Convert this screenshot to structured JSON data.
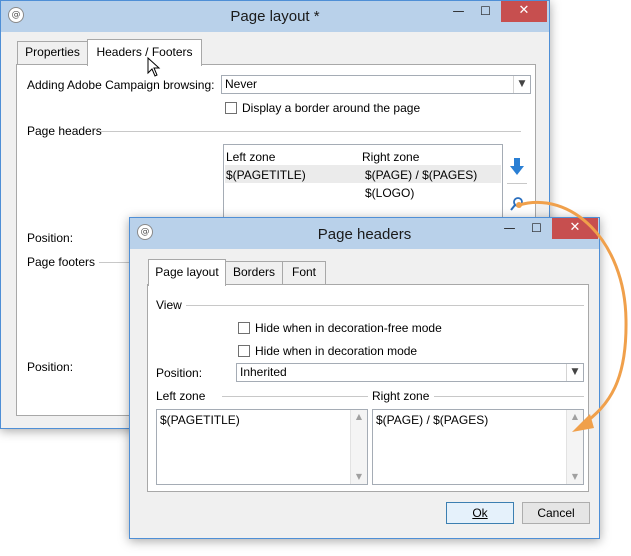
{
  "main_window": {
    "title": "Page layout *",
    "controls": {
      "minimize": "—",
      "maximize": "☐",
      "close": "✕"
    },
    "tabs": [
      {
        "label": "Properties",
        "active": false
      },
      {
        "label": "Headers / Footers",
        "active": true
      }
    ],
    "browsing_label": "Adding Adobe Campaign browsing:",
    "browsing_value": "Never",
    "border_checkbox_label": "Display a border around the page",
    "page_headers_label": "Page headers",
    "headers_table": {
      "columns": [
        "Left zone",
        "Right zone"
      ],
      "rows": [
        [
          "$(PAGETITLE)",
          "$(PAGE) / $(PAGES)"
        ],
        [
          "",
          "$(LOGO)"
        ]
      ]
    },
    "position_label": "Position:",
    "page_footers_label": "Page footers",
    "footer_position_label": "Position:"
  },
  "dialog": {
    "title": "Page headers",
    "controls": {
      "minimize": "—",
      "maximize": "☐",
      "close": "✕"
    },
    "tabs": [
      {
        "label": "Page layout",
        "active": true
      },
      {
        "label": "Borders",
        "active": false
      },
      {
        "label": "Font",
        "active": false
      }
    ],
    "view_label": "View",
    "hide_free_label": "Hide when in decoration-free mode",
    "hide_mode_label": "Hide when in decoration mode",
    "position_label": "Position:",
    "position_value": "Inherited",
    "left_zone_label": "Left zone",
    "left_zone_value": "$(PAGETITLE)",
    "right_zone_label": "Right zone",
    "right_zone_value": "$(PAGE) / $(PAGES)",
    "ok_label": "Ok",
    "cancel_label": "Cancel"
  },
  "colors": {
    "titlebar": "#b9d1ea",
    "close_button": "#c74f4f",
    "arrow_accent": "#f0a04b",
    "move_down_arrow": "#2a7fd4"
  }
}
